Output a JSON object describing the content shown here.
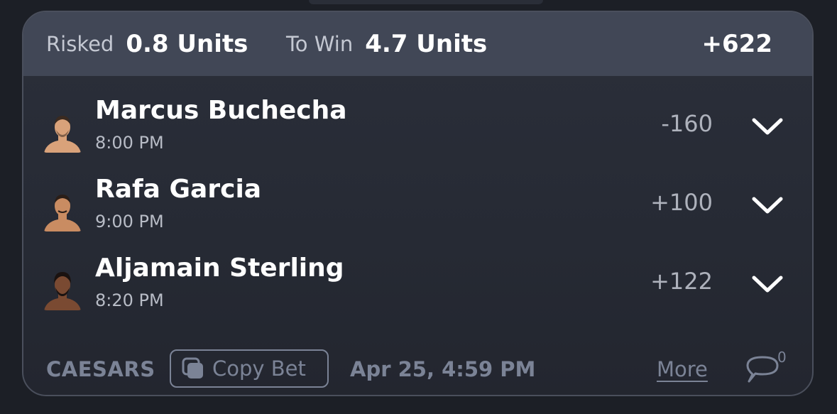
{
  "header": {
    "risked_label": "Risked",
    "risked_value": "0.8 Units",
    "towin_label": "To Win",
    "towin_value": "4.7 Units",
    "total_odds": "+622"
  },
  "legs": [
    {
      "name": "Marcus Buchecha",
      "time": "8:00 PM",
      "odds": "-160",
      "avatar": "fighter-headshot",
      "skin": "#d9a27a",
      "hair": "#3a2a20"
    },
    {
      "name": "Rafa Garcia",
      "time": "9:00 PM",
      "odds": "+100",
      "avatar": "fighter-headshot",
      "skin": "#c98c62",
      "hair": "#2a1e18"
    },
    {
      "name": "Aljamain Sterling",
      "time": "8:20 PM",
      "odds": "+122",
      "avatar": "fighter-headshot",
      "skin": "#7a4a32",
      "hair": "#1a1210"
    }
  ],
  "footer": {
    "sportsbook": "CAESARS",
    "copy_bet_label": "Copy Bet",
    "timestamp": "Apr 25, 4:59 PM",
    "more_label": "More",
    "comment_count": "0"
  },
  "colors": {
    "background": "#1c1f26",
    "card": "#2b2f3a",
    "header": "#414756",
    "muted": "#7b8396"
  }
}
